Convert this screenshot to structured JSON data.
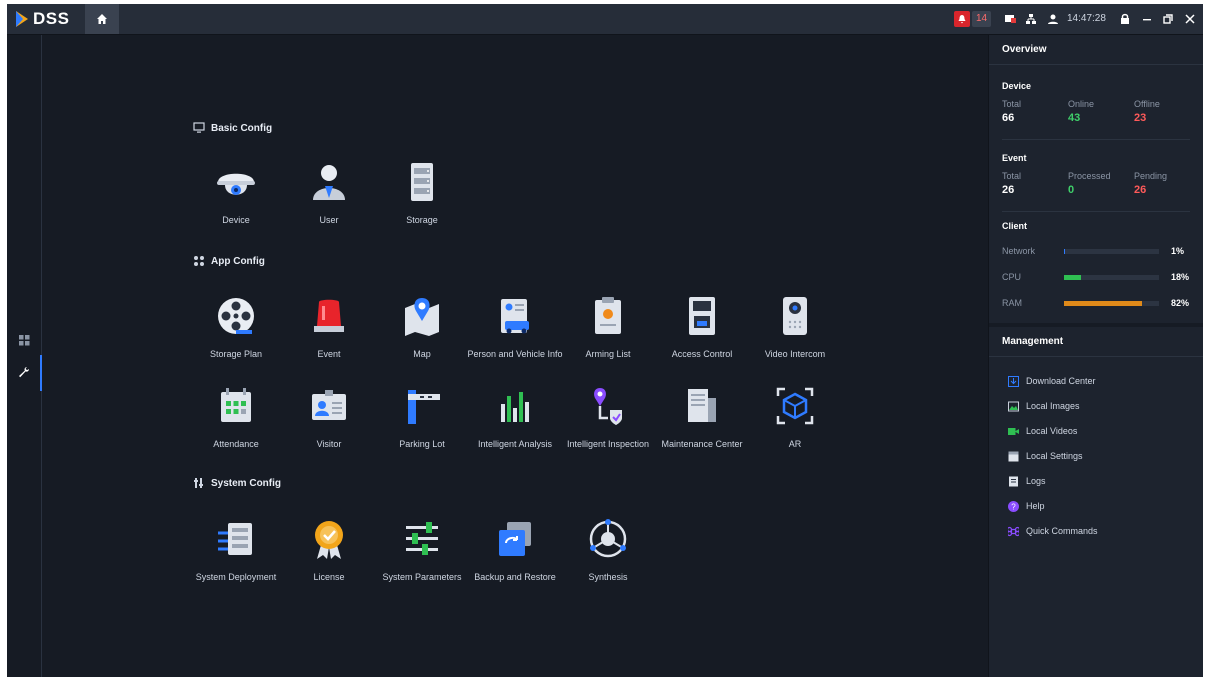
{
  "app": {
    "logo_text": "DSS"
  },
  "topbar": {
    "alarm_count": "14",
    "clock": "14:47:28",
    "icons": [
      "bell-icon",
      "event-icon",
      "tree-icon",
      "user-icon",
      "lock-icon",
      "minimize-icon",
      "restore-icon",
      "close-icon"
    ]
  },
  "sections": {
    "basic": "Basic Config",
    "app": "App Config",
    "system": "System Config"
  },
  "basic_tiles": [
    "Device",
    "User",
    "Storage"
  ],
  "app_tiles_row1": [
    "Storage Plan",
    "Event",
    "Map",
    "Person and Vehicle Info",
    "Arming List",
    "Access Control",
    "Video Intercom"
  ],
  "app_tiles_row2": [
    "Attendance",
    "Visitor",
    "Parking Lot",
    "Intelligent Analysis",
    "Intelligent Inspection",
    "Maintenance Center",
    "AR"
  ],
  "system_tiles": [
    "System Deployment",
    "License",
    "System Parameters",
    "Backup and Restore",
    "Synthesis"
  ],
  "overview": {
    "title": "Overview",
    "device": {
      "title": "Device",
      "total_label": "Total",
      "total": "66",
      "online_label": "Online",
      "online": "43",
      "offline_label": "Offline",
      "offline": "23"
    },
    "event": {
      "title": "Event",
      "total_label": "Total",
      "total": "26",
      "processed_label": "Processed",
      "processed": "0",
      "pending_label": "Pending",
      "pending": "26"
    },
    "client": {
      "title": "Client",
      "network_label": "Network",
      "network_pct": "1%",
      "network_value": 0.01,
      "cpu_label": "CPU",
      "cpu_pct": "18%",
      "cpu_value": 0.18,
      "ram_label": "RAM",
      "ram_pct": "82%",
      "ram_value": 0.82
    }
  },
  "management": {
    "title": "Management",
    "items": [
      "Download Center",
      "Local Images",
      "Local Videos",
      "Local Settings",
      "Logs",
      "Help",
      "Quick Commands"
    ]
  },
  "colors": {
    "accent": "#2f7bff",
    "online": "#3fcf6a",
    "offline": "#ff5a5a",
    "cpu_bar": "#2fbf52",
    "ram_bar": "#e08a1a",
    "alarm": "#d9252c"
  }
}
